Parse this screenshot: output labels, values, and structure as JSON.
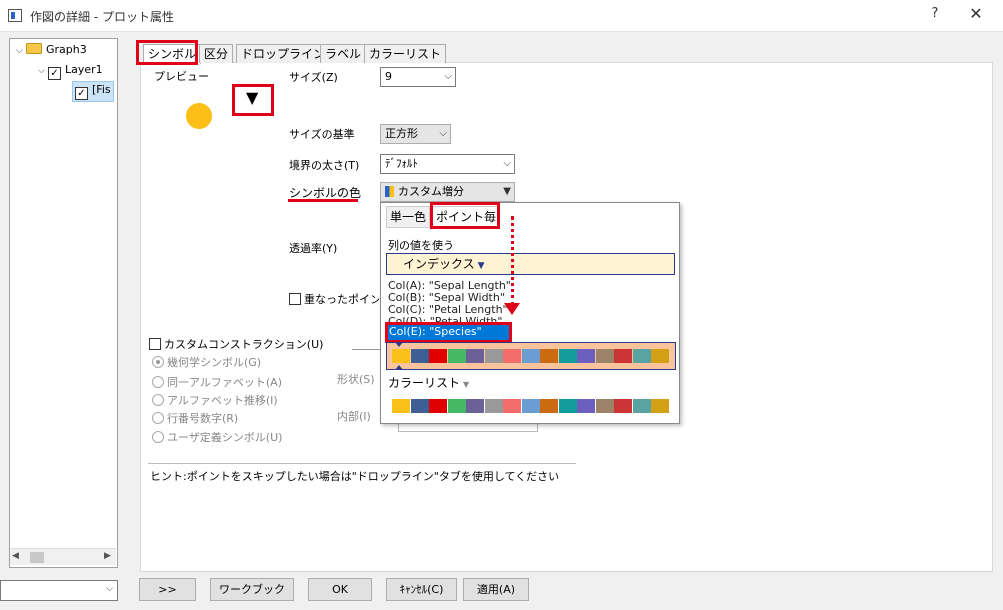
{
  "window": {
    "title": "作図の詳細 - プロット属性",
    "help": "?",
    "close": "✕"
  },
  "tree": {
    "graph": "Graph3",
    "layer": "Layer1",
    "item": "[Fis",
    "layer_checked": "✓",
    "item_checked": "✓"
  },
  "tabs": [
    "シンボル",
    "区分",
    "ドロップライン",
    "ラベル",
    "カラーリスト"
  ],
  "symbol": {
    "preview_label": "プレビュー",
    "preview_arrow": "▼",
    "size_label": "サイズ(Z)",
    "size_value": "9",
    "size_basis_label": "サイズの基準",
    "size_basis_value": "正方形",
    "edge_width_label": "境界の太さ(T)",
    "edge_width_value": "ﾃﾞﾌｫﾙﾄ",
    "symbol_color_label": "シンボルの色",
    "symbol_color_value": "カスタム増分",
    "transparency_label": "透過率(Y)",
    "overlap_label": "重なったポイン",
    "custom_construction_label": "カスタムコンストラクション(U)",
    "radio_options": [
      "幾何学シンボル(G)",
      "同一アルファベット(A)",
      "アルファベット推移(I)",
      "行番号数字(R)",
      "ユーザ定義シンボル(U)"
    ],
    "shape_label": "形状(S)",
    "interior_label": "内部(I)",
    "hint": "ヒント:ポイントをスキップしたい場合は\"ドロップライン\"タブを使用してください"
  },
  "popup": {
    "tabs": [
      "単一色",
      "ポイント毎"
    ],
    "col_values_label": "列の値を使う",
    "index_value": "インデックス",
    "columns": [
      "Col(A): \"Sepal Length\"",
      "Col(B): \"Sepal Width\"",
      "Col(C): \"Petal Length\"",
      "Col(D): \"Petal Width\"",
      "Col(E): \"Species\""
    ],
    "colorlist_label": "カラーリスト",
    "swatch_colors": [
      "#fbc01a",
      "#3d5f96",
      "#e00000",
      "#44b865",
      "#6c6098",
      "#999999",
      "#f36d6d",
      "#6a9ed2",
      "#cc6a12",
      "#129c9c",
      "#6c5fbd",
      "#9c8268",
      "#cc3535",
      "#5aa3a3",
      "#d3a015"
    ]
  },
  "buttons": {
    "expand": ">>",
    "workbook": "ワークブック",
    "ok": "OK",
    "cancel": "ｷｬﾝｾﾙ(C)",
    "apply": "適用(A)"
  },
  "icons": {
    "dropdown": "chevron-down-icon",
    "tree_expand": "chevron-down-icon"
  }
}
